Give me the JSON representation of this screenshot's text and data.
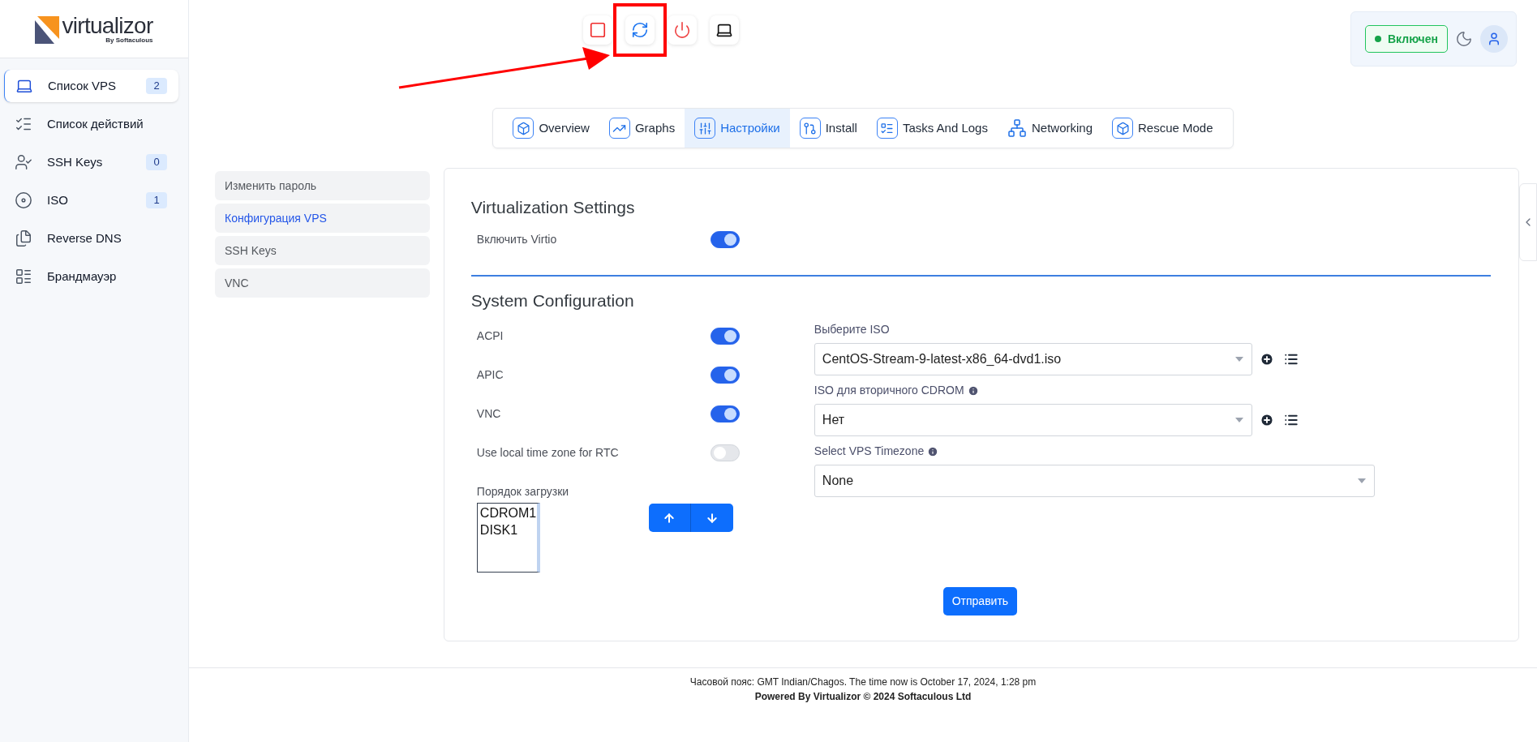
{
  "logo": {
    "name": "virtualizor",
    "tagline": "By Softaculous"
  },
  "sidebar": {
    "items": [
      {
        "label": "Список VPS",
        "badge": "2",
        "selected": true
      },
      {
        "label": "Список действий",
        "selected": false
      },
      {
        "label": "SSH Keys",
        "badge": "0",
        "selected": false
      },
      {
        "label": "ISO",
        "badge": "1",
        "selected": false
      },
      {
        "label": "Reverse DNS",
        "selected": false
      },
      {
        "label": "Брандмауэр",
        "selected": false
      }
    ]
  },
  "toolbar": [
    {
      "highlighted": false
    },
    {
      "highlighted": true
    },
    {
      "highlighted": false
    },
    {
      "highlighted": false
    }
  ],
  "status": {
    "label": "Включен",
    "on": true
  },
  "tabs": [
    {
      "label": "Overview",
      "selected": false
    },
    {
      "label": "Graphs",
      "selected": false
    },
    {
      "label": "Настройки",
      "selected": true
    },
    {
      "label": "Install",
      "selected": false
    },
    {
      "label": "Tasks And Logs",
      "selected": false
    },
    {
      "label": "Networking",
      "selected": false
    },
    {
      "label": "Rescue Mode",
      "selected": false
    }
  ],
  "subnav": [
    {
      "label": "Изменить пароль",
      "selected": false
    },
    {
      "label": "Конфигурация VPS",
      "selected": true
    },
    {
      "label": "SSH Keys",
      "selected": false
    },
    {
      "label": "VNC",
      "selected": false
    }
  ],
  "virtualization": {
    "title": "Virtualization Settings",
    "toggles": [
      {
        "label": "Включить Virtio",
        "on": true
      }
    ]
  },
  "system": {
    "title": "System Configuration",
    "toggles": [
      {
        "label": "ACPI",
        "on": true
      },
      {
        "label": "APIC",
        "on": true
      },
      {
        "label": "VNC",
        "on": true
      },
      {
        "label": "Use local time zone for RTC",
        "on": false
      }
    ],
    "boot_order": {
      "label": "Порядок загрузки",
      "items": [
        "CDROM1",
        "DISK1"
      ]
    },
    "selects": [
      {
        "label": "Выберите ISO",
        "value": "CentOS-Stream-9-latest-x86_64-dvd1.iso",
        "info": false,
        "actions": true
      },
      {
        "label": "ISO для вторичного CDROM",
        "value": "Нет",
        "info": true,
        "actions": true
      },
      {
        "label": "Select VPS Timezone",
        "value": "None",
        "info": true,
        "actions": false
      }
    ],
    "submit": "Отправить"
  },
  "footer": {
    "time_line": "Часовой пояс: GMT Indian/Chagos. The time now is October 17, 2024, 1:28 pm",
    "powered": "Powered By Virtualizor © 2024 Softaculous Ltd"
  }
}
